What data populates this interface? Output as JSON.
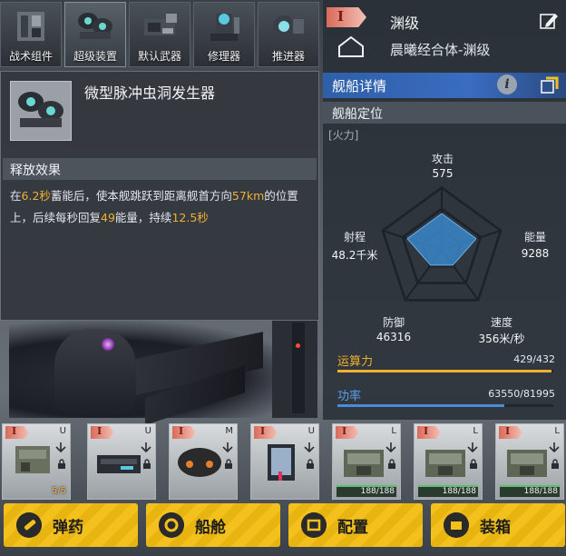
{
  "tabs": [
    {
      "label": "战术组件"
    },
    {
      "label": "超级装置"
    },
    {
      "label": "默认武器"
    },
    {
      "label": "修理器"
    },
    {
      "label": "推进器"
    }
  ],
  "tooltip": {
    "title": "微型脉冲虫洞发生器",
    "section_title": "释放效果",
    "desc_parts": [
      "在",
      "6.2秒",
      "蓄能后，使本舰跳跃到距离舰首方向",
      "57km",
      "的位置上，后续每秒回复",
      "49",
      "能量，持续",
      "12.5秒"
    ]
  },
  "ship": {
    "rank": "I",
    "class": "渊级",
    "name": "晨曦经合体-渊级"
  },
  "details": {
    "title": "舰船详情",
    "position_title": "舰船定位",
    "role": "[火力]",
    "stats": [
      {
        "label": "攻击",
        "value": "575",
        "level": 0.42
      },
      {
        "label": "能量",
        "value": "9288",
        "level": 0.42
      },
      {
        "label": "速度",
        "value": "356米/秒",
        "level": 0.22
      },
      {
        "label": "防御",
        "value": "46316",
        "level": 0.22
      },
      {
        "label": "射程",
        "value": "48.2千米",
        "level": 0.42
      }
    ],
    "compute": {
      "label": "运算力",
      "value": "429/432",
      "fraction": 0.993
    },
    "power": {
      "label": "功率",
      "value": "63550/81995",
      "fraction": 0.775
    }
  },
  "slots": [
    {
      "rank": "I",
      "size": "U",
      "type": "cannon",
      "footer": "5/5",
      "footer_kind": "count"
    },
    {
      "rank": "I",
      "size": "U",
      "type": "hangar",
      "footer": "",
      "footer_kind": ""
    },
    {
      "rank": "I",
      "size": "M",
      "type": "engine",
      "footer": "",
      "footer_kind": ""
    },
    {
      "rank": "I",
      "size": "U",
      "type": "special",
      "footer": "",
      "footer_kind": ""
    },
    {
      "rank": "I",
      "size": "L",
      "type": "turret",
      "footer": "188/188",
      "footer_kind": "dur"
    },
    {
      "rank": "I",
      "size": "L",
      "type": "turret",
      "footer": "188/188",
      "footer_kind": "dur"
    },
    {
      "rank": "I",
      "size": "L",
      "type": "turret",
      "footer": "188/188",
      "footer_kind": "dur"
    }
  ],
  "bottom_buttons": [
    {
      "label": "弹药",
      "icon": "ammo-icon"
    },
    {
      "label": "船舱",
      "icon": "cabin-icon"
    },
    {
      "label": "配置",
      "icon": "config-icon"
    },
    {
      "label": "装箱",
      "icon": "box-icon"
    }
  ],
  "colors": {
    "accent": "#3a6cc0",
    "highlight": "#f0b030",
    "button": "#f3c01e",
    "rank": "#d86a5a"
  }
}
